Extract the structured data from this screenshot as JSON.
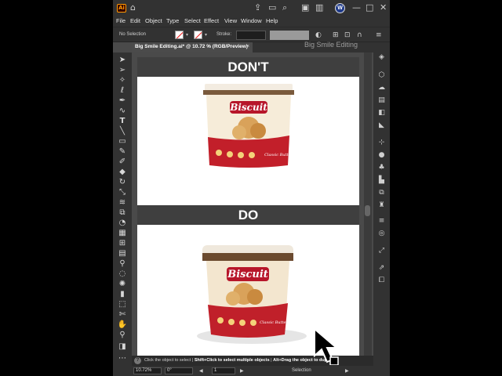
{
  "window": {
    "app_logo": "Ai",
    "avatar_label": "W"
  },
  "menu": [
    "File",
    "Edit",
    "Object",
    "Type",
    "Select",
    "Effect",
    "View",
    "Window",
    "Help"
  ],
  "control_bar": {
    "selection": "No Selection",
    "stroke_label": "Stroke:"
  },
  "document_tab": {
    "title": "Big Smile Editing.ai* @ 10.72 % (RGB/Preview)",
    "close_glyph": "×"
  },
  "watermark": "Big Smile Editing",
  "artboard": {
    "banner_top": "DON'T",
    "banner_bottom": "DO",
    "product_brand": "Biscuit",
    "product_tag": "Classic Butter"
  },
  "status": {
    "hint_1": "Click the object to select",
    "hint_2": "Shift+Click to select multiple objects",
    "hint_3": "Alt+Drag the object to duplicate"
  },
  "bottom_bar": {
    "zoom": "10.72%",
    "rotation": "0°",
    "artboard_number": "1",
    "mode": "Selection"
  },
  "colors": {
    "app_background": "#4a4a4a",
    "panel": "#323232",
    "banner": "#3f3f3f",
    "accent_red": "#c0202a",
    "lid_brown": "#6b4a2f"
  }
}
